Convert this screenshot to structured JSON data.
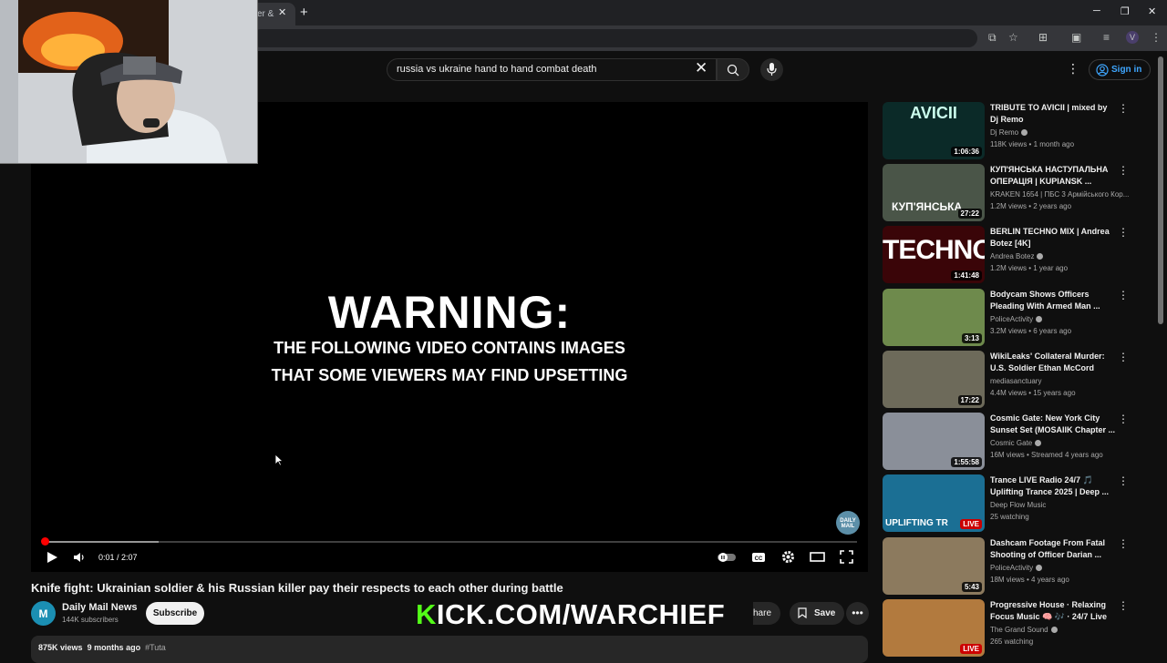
{
  "browser": {
    "tab_title": "er &",
    "tab_close": "✕",
    "new_tab": "+",
    "window_minimize": "─",
    "window_restore": "❐",
    "window_close": "✕"
  },
  "header": {
    "search_query": "russia vs ukraine hand to hand combat death",
    "clear_icon": "✕",
    "more_icon": "⋮",
    "signin_label": "Sign in"
  },
  "player": {
    "warning_title": "WARNING:",
    "warning_line1": "THE FOLLOWING VIDEO CONTAINS IMAGES",
    "warning_line2": "THAT SOME VIEWERS MAY FIND UPSETTING",
    "time_display": "0:01 / 2:07",
    "progress_fraction": 0.008,
    "watermark": "DAILY MAIL"
  },
  "video": {
    "title": "Knife fight: Ukrainian soldier & his Russian killer pay their respects to each other during battle",
    "channel_name": "Daily Mail News",
    "channel_avatar": "M",
    "subscribers": "144K subscribers",
    "subscribe_label": "Subscribe",
    "share_label": "hare",
    "save_label": "Save",
    "more_label": "•••",
    "views": "875K views",
    "age": "9 months ago",
    "tag": "#Tuta"
  },
  "overlay": {
    "kick_k": "K",
    "kick_rest": "ICK.COM/WARCHIEF"
  },
  "recommendations": [
    {
      "title": "TRIBUTE TO AVICII | mixed by Dj Remo",
      "channel": "Dj Remo",
      "verified": true,
      "views": "118K views",
      "age": "1 month ago",
      "duration": "1:06:36",
      "thumb_text": "AVICII",
      "thumb_color": "#0b2a28",
      "live": false
    },
    {
      "title": "КУП'ЯНСЬКА НАСТУПАЛЬНА ОПЕРАЦІЯ | KUPIANSK ...",
      "channel": "KRAKEN 1654 | ПБС 3 Армійського Кор...",
      "verified": false,
      "views": "1.2M views",
      "age": "2 years ago",
      "duration": "27:22",
      "thumb_text": "КУП'ЯНСЬКА",
      "thumb_color": "#4a5548",
      "live": false
    },
    {
      "title": "BERLIN TECHNO MIX | Andrea Botez [4K]",
      "channel": "Andrea Botez",
      "verified": true,
      "views": "1.2M views",
      "age": "1 year ago",
      "duration": "1:41:48",
      "thumb_text": "TECHNO",
      "thumb_color": "#3a0508",
      "live": false
    },
    {
      "title": "Bodycam Shows Officers Pleading With Armed Man ...",
      "channel": "PoliceActivity",
      "verified": true,
      "views": "3.2M views",
      "age": "6 years ago",
      "duration": "3:13",
      "thumb_text": "",
      "thumb_color": "#6e8a4c",
      "live": false
    },
    {
      "title": "WikiLeaks' Collateral Murder: U.S. Soldier Ethan McCord",
      "channel": "mediasanctuary",
      "verified": false,
      "views": "4.4M views",
      "age": "15 years ago",
      "duration": "17:22",
      "thumb_text": "",
      "thumb_color": "#6d6a5a",
      "live": false
    },
    {
      "title": "Cosmic Gate: New York City Sunset Set (MOSAIIK Chapter ...",
      "channel": "Cosmic Gate",
      "verified": true,
      "views": "16M views",
      "age": "Streamed 4 years ago",
      "duration": "1:55:58",
      "thumb_text": "",
      "thumb_color": "#8a8f99",
      "live": false
    },
    {
      "title": "Trance  LIVE Radio 24/7 🎵 Uplifting Trance 2025 | Deep ...",
      "channel": "Deep Flow Music",
      "verified": false,
      "views": "25 watching",
      "age": "",
      "duration": "LIVE",
      "thumb_text": "UPLIFTING TR",
      "thumb_color": "#1b6f94",
      "live": true
    },
    {
      "title": "Dashcam Footage From Fatal Shooting of Officer Darian ...",
      "channel": "PoliceActivity",
      "verified": true,
      "views": "18M views",
      "age": "4 years ago",
      "duration": "5:43",
      "thumb_text": "",
      "thumb_color": "#8c7a5e",
      "live": false
    },
    {
      "title": "Progressive House · Relaxing Focus Music 🧠 🎶 · 24/7 Live",
      "channel": "The Grand Sound",
      "verified": true,
      "views": "265 watching",
      "age": "",
      "duration": "LIVE",
      "thumb_text": "",
      "thumb_color": "#b27a3e",
      "live": true
    }
  ]
}
